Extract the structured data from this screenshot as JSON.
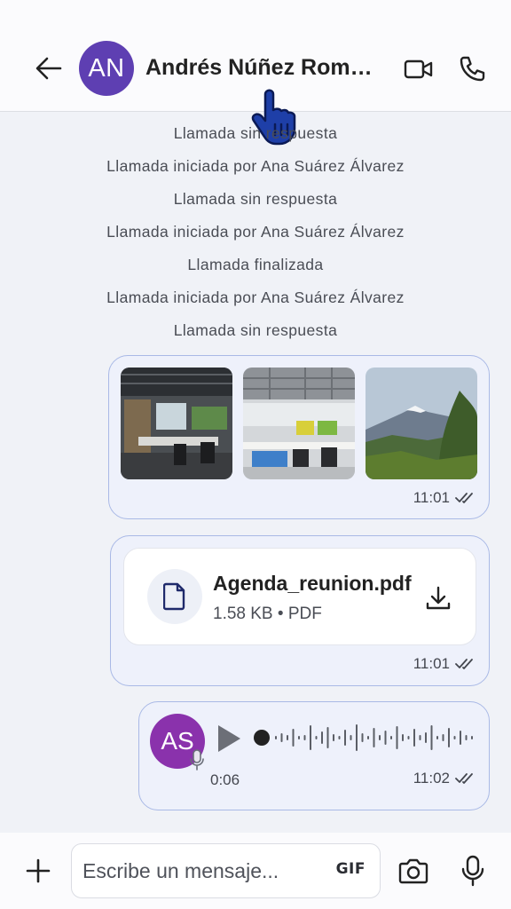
{
  "header": {
    "avatar_initials": "AN",
    "contact_name": "Andrés Núñez Romero",
    "icons": {
      "back": "arrow-left-icon",
      "video": "video-camera-icon",
      "call": "phone-icon"
    }
  },
  "system_messages": [
    "Llamada sin respuesta",
    "Llamada iniciada por Ana Suárez Álvarez",
    "Llamada sin respuesta",
    "Llamada iniciada por Ana Suárez Álvarez",
    "Llamada finalizada",
    "Llamada iniciada por Ana Suárez Álvarez",
    "Llamada sin respuesta"
  ],
  "messages": {
    "images": {
      "time": "11:01",
      "status": "double-check-icon",
      "count": 3
    },
    "file": {
      "name": "Agenda_reunion.pdf",
      "size": "1.58 KB",
      "type": "PDF",
      "info": "1.58 KB • PDF",
      "time": "11:01",
      "status": "double-check-icon"
    },
    "audio": {
      "avatar_initials": "AS",
      "duration": "0:06",
      "time": "11:02",
      "status": "double-check-icon",
      "progress": 0
    }
  },
  "composer": {
    "placeholder": "Escribe un mensaje...",
    "gif_label": "GIF",
    "icons": {
      "add": "plus-icon",
      "camera": "camera-icon",
      "mic": "microphone-icon"
    }
  },
  "colors": {
    "avatar_an": "#5e3fb2",
    "avatar_as": "#8a32ac",
    "bubble_bg": "#eef1fb",
    "bubble_border": "#a9b9e6",
    "file_icon": "#1f2a6b"
  }
}
